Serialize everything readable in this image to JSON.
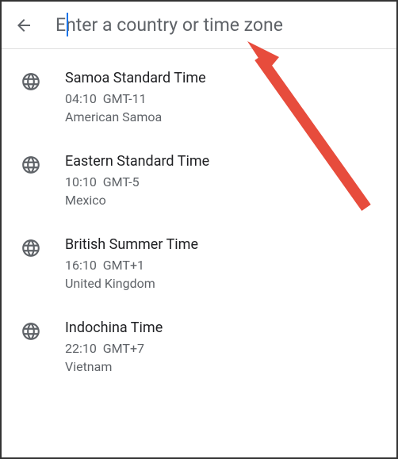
{
  "search": {
    "placeholder": "Enter a country or time zone",
    "value": ""
  },
  "timezones": [
    {
      "name": "Samoa Standard Time",
      "time": "04:10",
      "offset": "GMT-11",
      "location": "American Samoa"
    },
    {
      "name": "Eastern Standard Time",
      "time": "10:10",
      "offset": "GMT-5",
      "location": "Mexico"
    },
    {
      "name": "British Summer Time",
      "time": "16:10",
      "offset": "GMT+1",
      "location": "United Kingdom"
    },
    {
      "name": "Indochina Time",
      "time": "22:10",
      "offset": "GMT+7",
      "location": "Vietnam"
    }
  ]
}
